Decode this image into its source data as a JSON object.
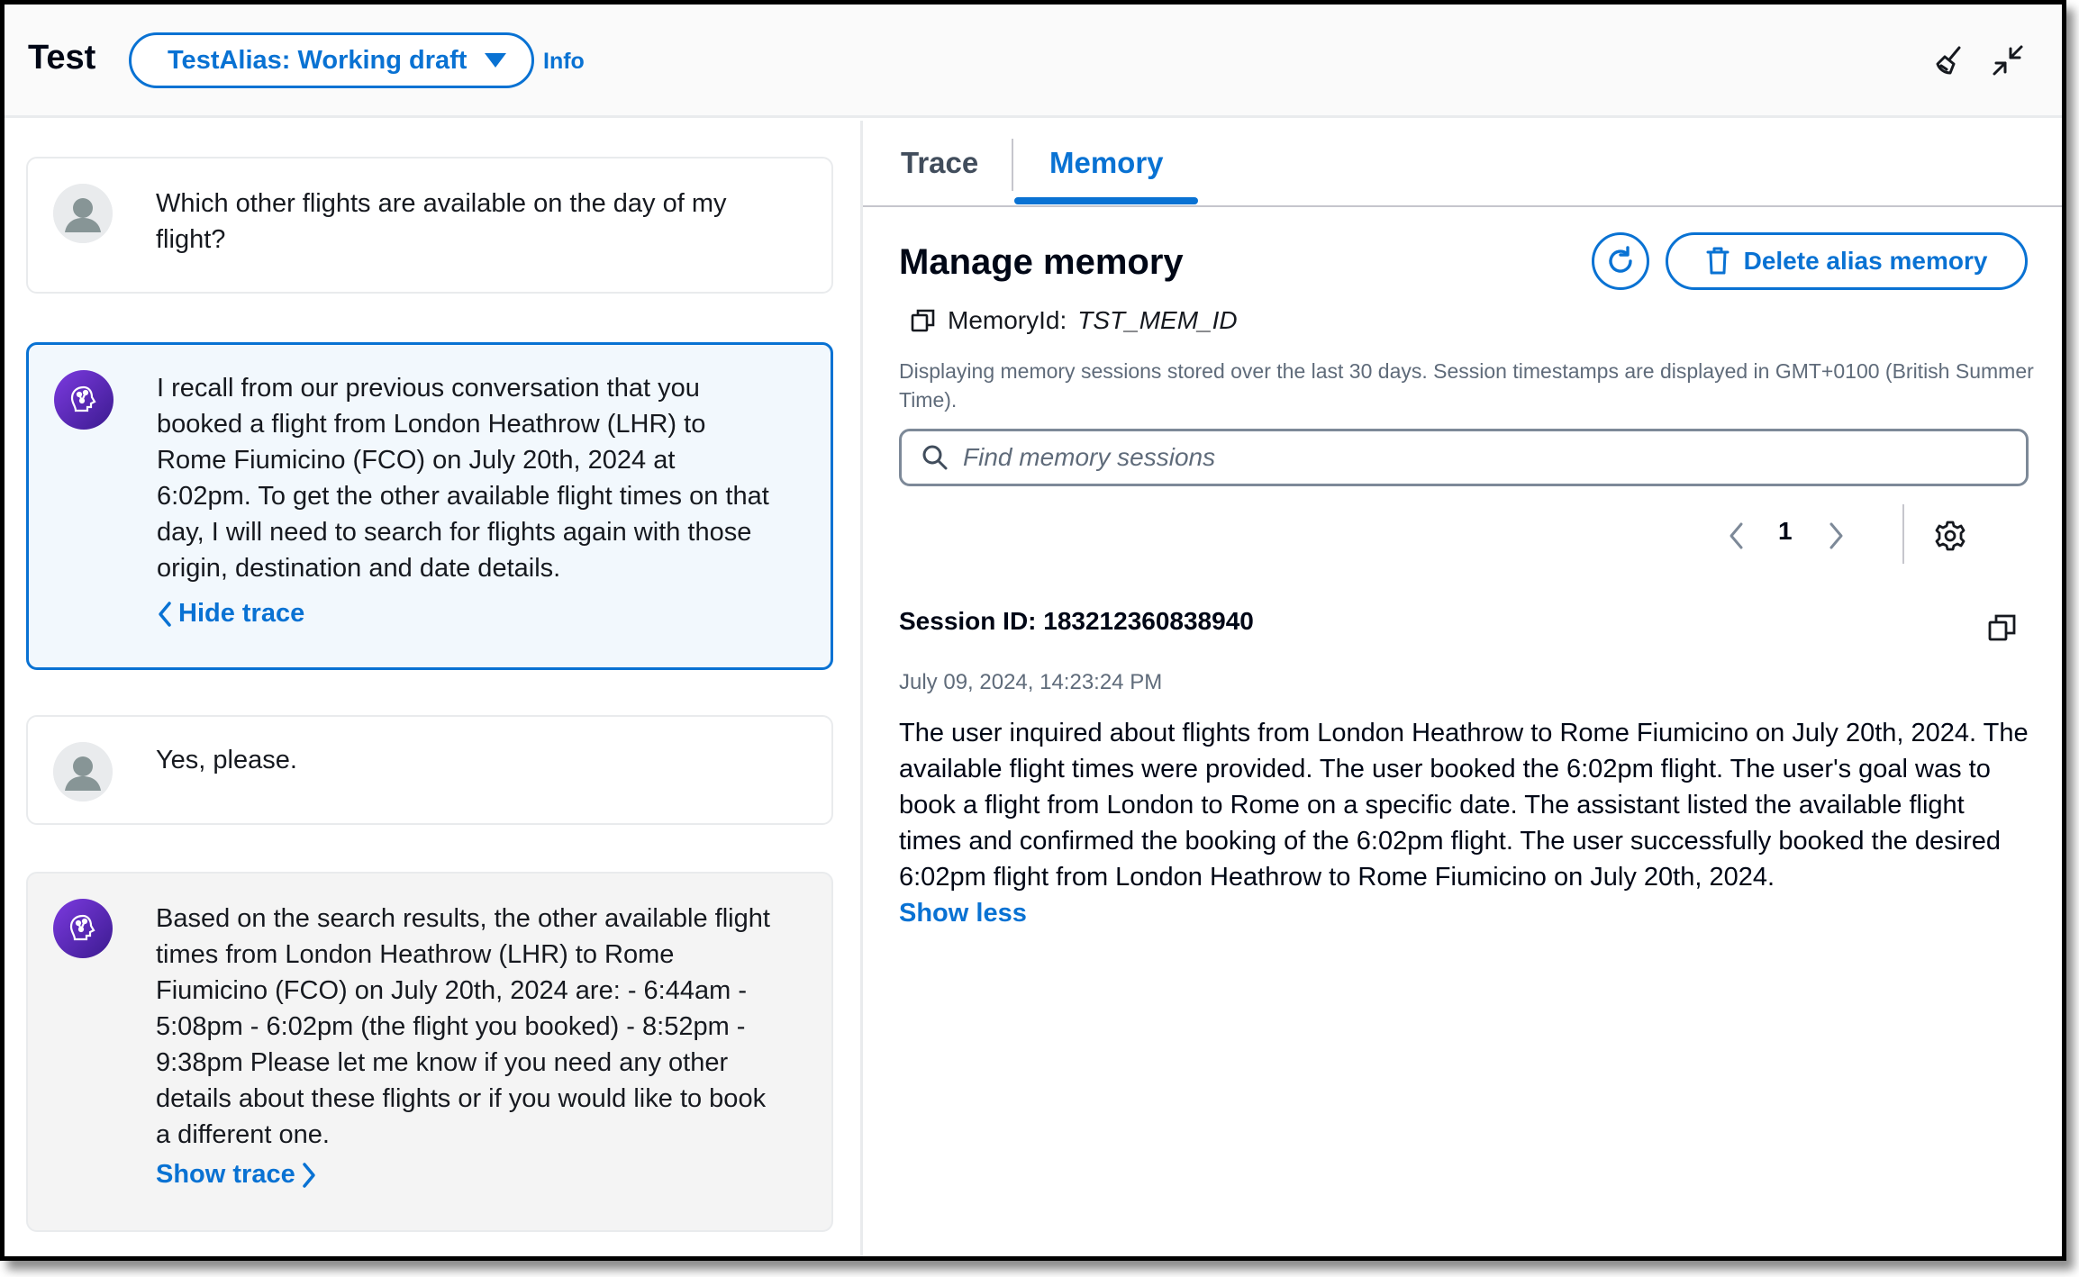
{
  "header": {
    "title": "Test",
    "alias_selector": "TestAlias: Working draft",
    "info_link": "Info"
  },
  "chat": {
    "messages": [
      {
        "role": "user",
        "text": "Which other flights are available on the day of my flight?"
      },
      {
        "role": "agent",
        "text": "I recall from our previous conversation that you booked a flight from London Heathrow (LHR) to Rome Fiumicino (FCO) on July 20th, 2024 at 6:02pm. To get the other available flight times on that day, I will need to search for flights again with those origin, destination and date details.",
        "trace_link": "Hide trace"
      },
      {
        "role": "user",
        "text": "Yes, please."
      },
      {
        "role": "agent",
        "text": "Based on the search results, the other available flight times from London Heathrow (LHR) to Rome Fiumicino (FCO) on July 20th, 2024 are: - 6:44am - 5:08pm - 6:02pm (the flight you booked) - 8:52pm - 9:38pm Please let me know if you need any other details about these flights or if you would like to book a different one.",
        "trace_link": "Show trace"
      }
    ]
  },
  "tabs": [
    {
      "label": "Trace",
      "active": false
    },
    {
      "label": "Memory",
      "active": true
    }
  ],
  "memory": {
    "title": "Manage memory",
    "delete_button": "Delete alias memory",
    "memory_id_label": "MemoryId:",
    "memory_id_value": "TST_MEM_ID",
    "description": "Displaying memory sessions stored over the last 30 days. Session timestamps are displayed in GMT+0100 (British Summer Time).",
    "search_placeholder": "Find memory sessions",
    "pagination": {
      "current_page": "1"
    },
    "session": {
      "id_label": "Session ID: 183212360838940",
      "timestamp": "July 09, 2024, 14:23:24 PM",
      "summary": "The user inquired about flights from London Heathrow to Rome Fiumicino on July 20th, 2024. The available flight times were provided. The user booked the 6:02pm flight. The user's goal was to book a flight from London to Rome on a specific date. The assistant listed the available flight times and confirmed the booking of the 6:02pm flight. The user successfully booked the desired 6:02pm flight from London Heathrow to Rome Fiumicino on July 20th, 2024.",
      "toggle_label": "Show less"
    }
  },
  "colors": {
    "accent": "#0972d3",
    "text_primary": "#000716",
    "text_secondary": "#5f6b7a",
    "border": "#e9ebed",
    "bot_avatar": "#5b2bc4"
  }
}
